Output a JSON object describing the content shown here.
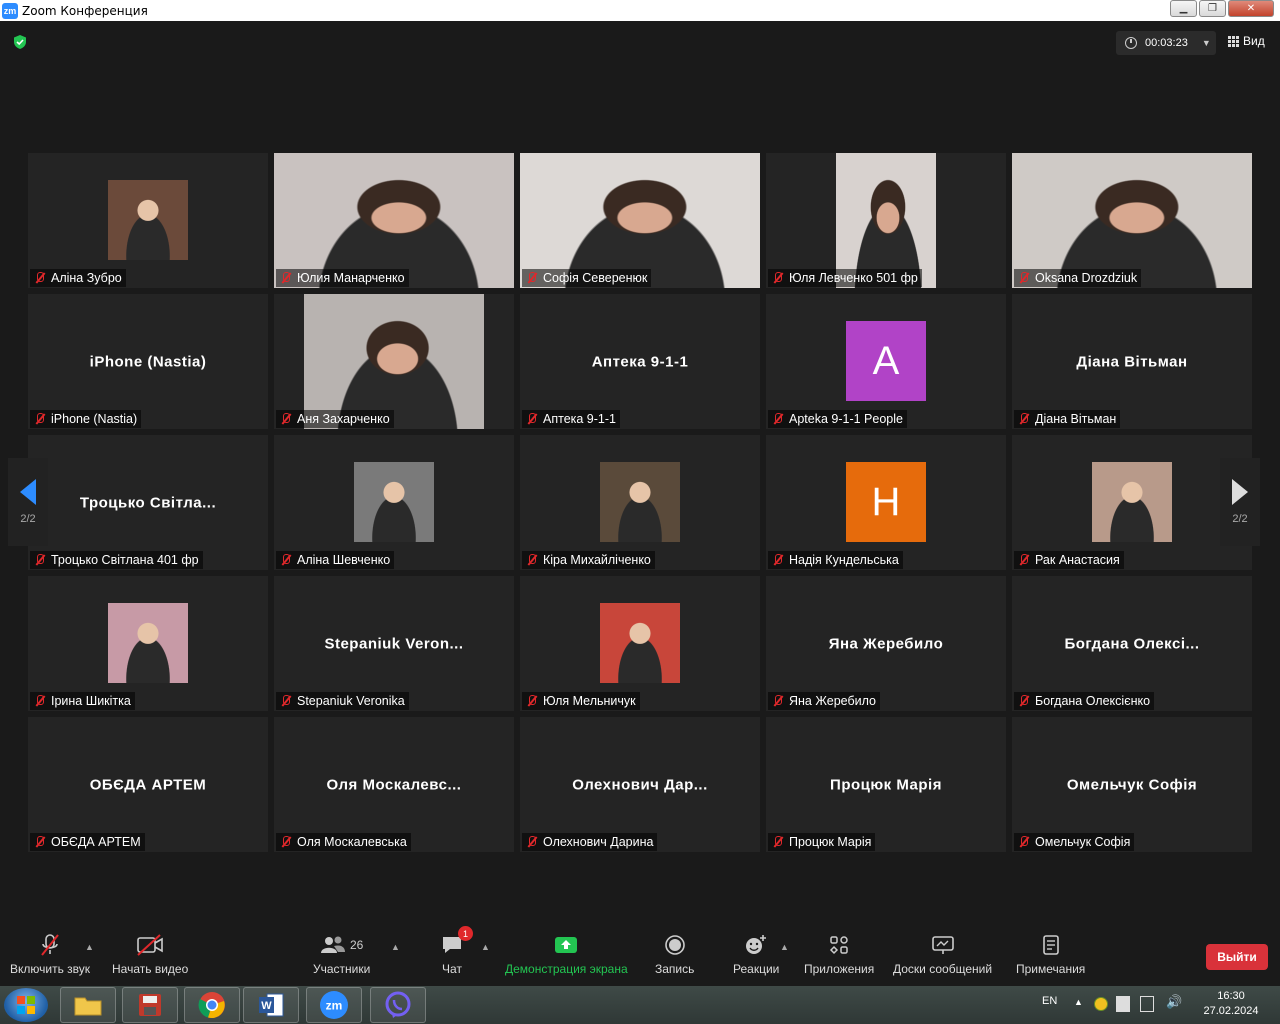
{
  "window": {
    "title": "Zoom Конференция",
    "logo": "zm"
  },
  "topbar": {
    "timer": "00:03:23",
    "view_label": "Вид"
  },
  "pager": {
    "left": "2/2",
    "right": "2/2"
  },
  "tiles": [
    {
      "name": "Аліна Зубро",
      "kind": "photo",
      "color": "#6b4a3a"
    },
    {
      "name": "Юлия Манарченко",
      "kind": "video",
      "color": "#c9c2c0",
      "active": true
    },
    {
      "name": "Софія Северенюк",
      "kind": "video",
      "color": "#ddd9d6"
    },
    {
      "name": "Юля Левченко 501 фр",
      "kind": "video",
      "color": "#d8d2cf"
    },
    {
      "name": "Oksana Drozdziuk",
      "kind": "video",
      "color": "#cfcac6"
    },
    {
      "name": "iPhone (Nastia)",
      "big": "iPhone (Nastia)",
      "kind": "text"
    },
    {
      "name": "Аня Захарченко",
      "kind": "video",
      "color": "#b8b3b0"
    },
    {
      "name": "Аптека 9-1-1",
      "big": "Аптека 9-1-1",
      "kind": "text"
    },
    {
      "name": "Apteka 9-1-1 People",
      "kind": "letter",
      "letter": "A",
      "color": "#b143c7"
    },
    {
      "name": "Діана Вітьман",
      "big": "Діана Вітьман",
      "kind": "text"
    },
    {
      "name": "Троцько Світлана 401 фр",
      "big": "Троцько Світла...",
      "kind": "text"
    },
    {
      "name": "Аліна Шевченко",
      "kind": "photo",
      "color": "#7a7a7a"
    },
    {
      "name": "Кіра Михайліченко",
      "kind": "photo",
      "color": "#5a4a3a"
    },
    {
      "name": "Надія Кундельська",
      "kind": "letter",
      "letter": "H",
      "color": "#e66b0c"
    },
    {
      "name": "Рак Анастасия",
      "kind": "photo",
      "color": "#b89a8a"
    },
    {
      "name": "Ірина Шикітка",
      "kind": "photo",
      "color": "#c79aa6"
    },
    {
      "name": "Stepaniuk Veronika",
      "big": "Stepaniuk Veron...",
      "kind": "text"
    },
    {
      "name": "Юля Мельничук",
      "kind": "photo",
      "color": "#c8463a"
    },
    {
      "name": "Яна Жеребило",
      "big": "Яна Жеребило",
      "kind": "text"
    },
    {
      "name": "Богдана Олексієнко",
      "big": "Богдана Олексі...",
      "kind": "text"
    },
    {
      "name": "ОБЄДА АРТЕМ",
      "big": "ОБЄДА АРТЕМ",
      "kind": "text"
    },
    {
      "name": "Оля Москалевська",
      "big": "Оля Москалевс...",
      "kind": "text"
    },
    {
      "name": "Олехнович Дарина",
      "big": "Олехнович Дар...",
      "kind": "text"
    },
    {
      "name": "Процюк Марія",
      "big": "Процюк Марія",
      "kind": "text"
    },
    {
      "name": "Омельчук Софія",
      "big": "Омельчук Софія",
      "kind": "text"
    }
  ],
  "toolbar": {
    "mute": "Включить звук",
    "video": "Начать видео",
    "participants": "Участники",
    "participants_count": "26",
    "chat": "Чат",
    "chat_badge": "1",
    "share": "Демонстрация экрана",
    "record": "Запись",
    "reactions": "Реакции",
    "apps": "Приложения",
    "whiteboards": "Доски сообщений",
    "notes": "Примечания",
    "leave": "Выйти"
  },
  "taskbar": {
    "lang": "EN",
    "time": "16:30",
    "date": "27.02.2024",
    "apps": [
      "explorer",
      "save",
      "chrome",
      "word",
      "zoom",
      "viber"
    ]
  },
  "colors": {
    "accent_green": "#23c552",
    "active_border": "#c8f04a",
    "leave_red": "#d9323a",
    "pager_blue": "#2d8cff"
  }
}
